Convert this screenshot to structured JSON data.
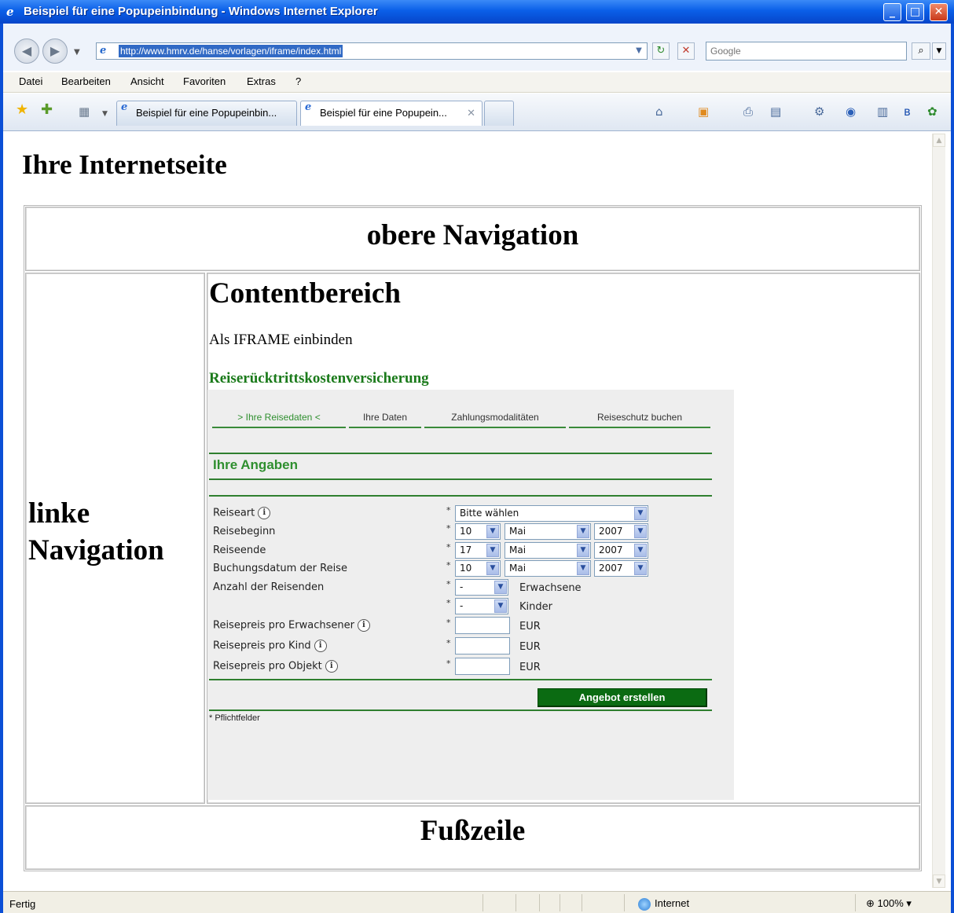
{
  "window": {
    "title": "Beispiel für eine Popupeinbindung - Windows Internet Explorer",
    "controls": {
      "minimize": "_",
      "maximize": "□",
      "close": "✕"
    }
  },
  "address": {
    "url": "http://www.hmrv.de/hanse/vorlagen/iframe/index.html",
    "search_placeholder": "Google"
  },
  "menu": [
    "Datei",
    "Bearbeiten",
    "Ansicht",
    "Favoriten",
    "Extras",
    "?"
  ],
  "tabs": [
    {
      "label": "Beispiel für eine Popupeinbin..."
    },
    {
      "label": "Beispiel für eine Popupein..."
    }
  ],
  "page": {
    "heading": "Ihre Internetseite",
    "top_nav": "obere Navigation",
    "left_nav": [
      "linke",
      "Navigation"
    ],
    "content_heading": "Contentbereich",
    "iframe_text": "Als IFRAME einbinden",
    "insurance_title": "Reiserücktrittskostenversicherung",
    "footer": "Fußzeile"
  },
  "form": {
    "steps": [
      "> Ihre Reisedaten <",
      "Ihre Daten",
      "Zahlungsmodalitäten",
      "Reiseschutz buchen"
    ],
    "section_title": "Ihre Angaben",
    "labels": {
      "reiseart": "Reiseart",
      "reisebeginn": "Reisebeginn",
      "reiseende": "Reiseende",
      "buchungsdatum": "Buchungsdatum der Reise",
      "anzahl": "Anzahl der Reisenden",
      "preis_erwachsener": "Reisepreis pro Erwachsener",
      "preis_kind": "Reisepreis pro Kind",
      "preis_objekt": "Reisepreis pro Objekt"
    },
    "required_mark": "*",
    "info_glyph": "i",
    "reiseart_value": "Bitte wählen",
    "reisebeginn": {
      "day": "10",
      "month": "Mai",
      "year": "2007"
    },
    "reiseende": {
      "day": "17",
      "month": "Mai",
      "year": "2007"
    },
    "buchungsdatum": {
      "day": "10",
      "month": "Mai",
      "year": "2007"
    },
    "erwachsene_value": "-",
    "kinder_value": "-",
    "unit_erwachsene": "Erwachsene",
    "unit_kinder": "Kinder",
    "currency": "EUR",
    "submit": "Angebot erstellen",
    "required_note": "* Pflichtfelder"
  },
  "status": {
    "text": "Fertig",
    "zone": "Internet",
    "zoom": "100%"
  },
  "colors": {
    "titlebar": "#0a5fe8",
    "brand_green": "#2f8f2f",
    "button_green": "#0b6b12"
  }
}
